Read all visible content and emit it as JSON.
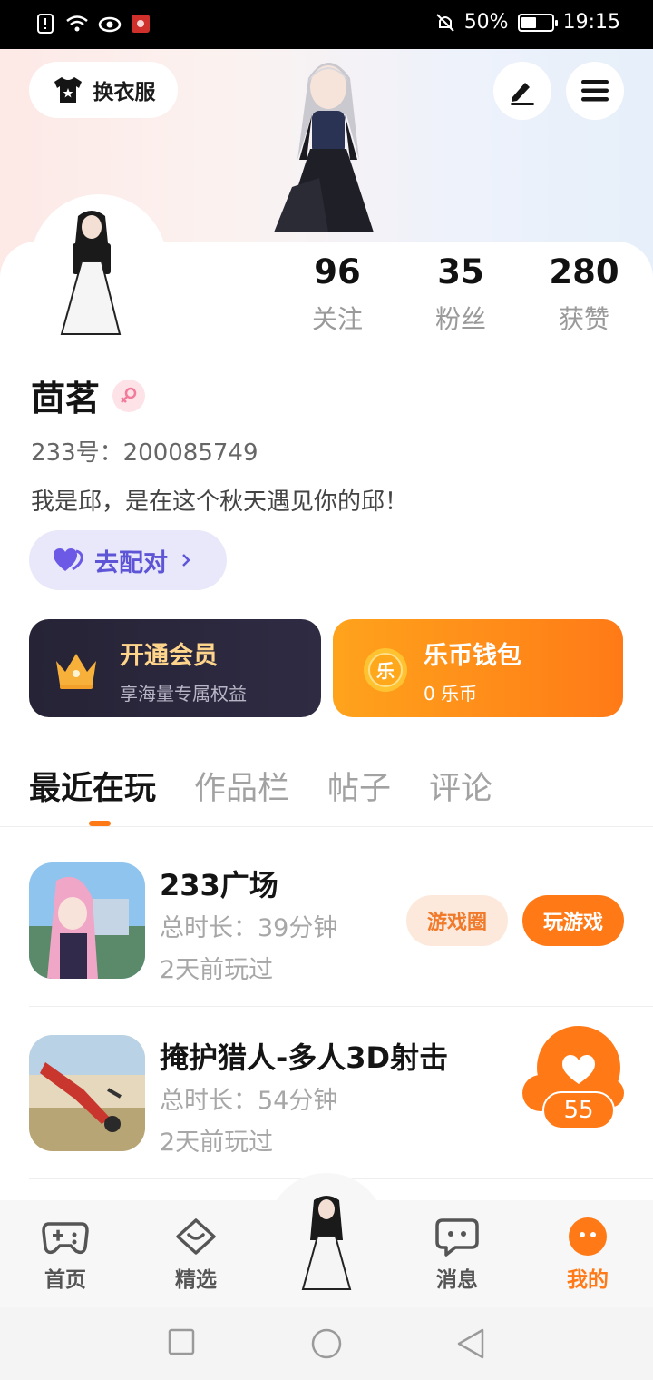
{
  "status_bar": {
    "battery": "50%",
    "battery_level": 0.5,
    "time": "19:15",
    "icons": [
      "alert-icon",
      "wifi-icon",
      "eye-icon",
      "huawei-icon",
      "mute-icon",
      "battery-icon"
    ]
  },
  "header": {
    "dress_label": "换衣服",
    "edit_icon": "pen-icon",
    "menu_icon": "hamburger-icon"
  },
  "stats": [
    {
      "value": "96",
      "label": "关注"
    },
    {
      "value": "35",
      "label": "粉丝"
    },
    {
      "value": "280",
      "label": "获赞"
    }
  ],
  "profile": {
    "name": "茴茗",
    "gender_icon": "female-icon",
    "uid": "233号：200085749",
    "bio": "我是邱，是在这个秋天遇见你的邱！",
    "pair_label": "去配对"
  },
  "cards": {
    "vip": {
      "title": "开通会员",
      "subtitle": "享海量专属权益",
      "title_color": "#ffd58c"
    },
    "wallet": {
      "title": "乐币钱包",
      "subtitle": "0 乐币",
      "coin_glyph": "乐"
    }
  },
  "tabs": [
    "最近在玩",
    "作品栏",
    "帖子",
    "评论"
  ],
  "active_tab": 0,
  "games": [
    {
      "name": "233广场",
      "duration": "总时长：39分钟",
      "last_played": "2天前玩过",
      "circle_label": "游戏圈",
      "play_label": "玩游戏"
    },
    {
      "name": "掩护猎人-多人3D射击",
      "duration": "总时长：54分钟",
      "last_played": "2天前玩过"
    }
  ],
  "like_float": {
    "count": "55",
    "icon": "heart-icon"
  },
  "bottom_nav": [
    {
      "label": "首页",
      "icon": "gamepad-icon"
    },
    {
      "label": "精选",
      "icon": "heart-chat-icon"
    },
    {
      "label": "",
      "icon": "avatar"
    },
    {
      "label": "消息",
      "icon": "message-icon"
    },
    {
      "label": "我的",
      "icon": "profile-face-icon",
      "active": true
    }
  ],
  "accent": "#ff7a17"
}
